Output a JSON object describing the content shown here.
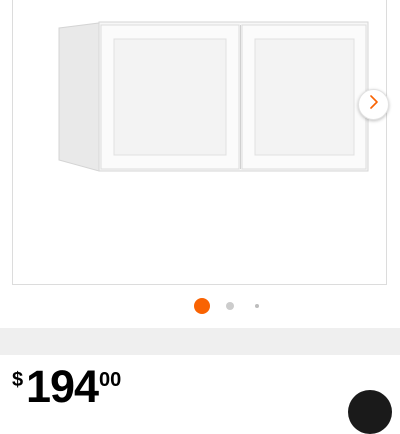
{
  "gallery": {
    "image_subject": "white-shaker-wall-cabinet",
    "next_icon": "chevron-right-icon",
    "slide_count": 3,
    "active_slide": 1
  },
  "price": {
    "currency_symbol": "$",
    "dollars": "194",
    "cents": "00"
  },
  "colors": {
    "accent": "#f96302",
    "dot_inactive": "#cccccc",
    "band": "#efefef"
  }
}
